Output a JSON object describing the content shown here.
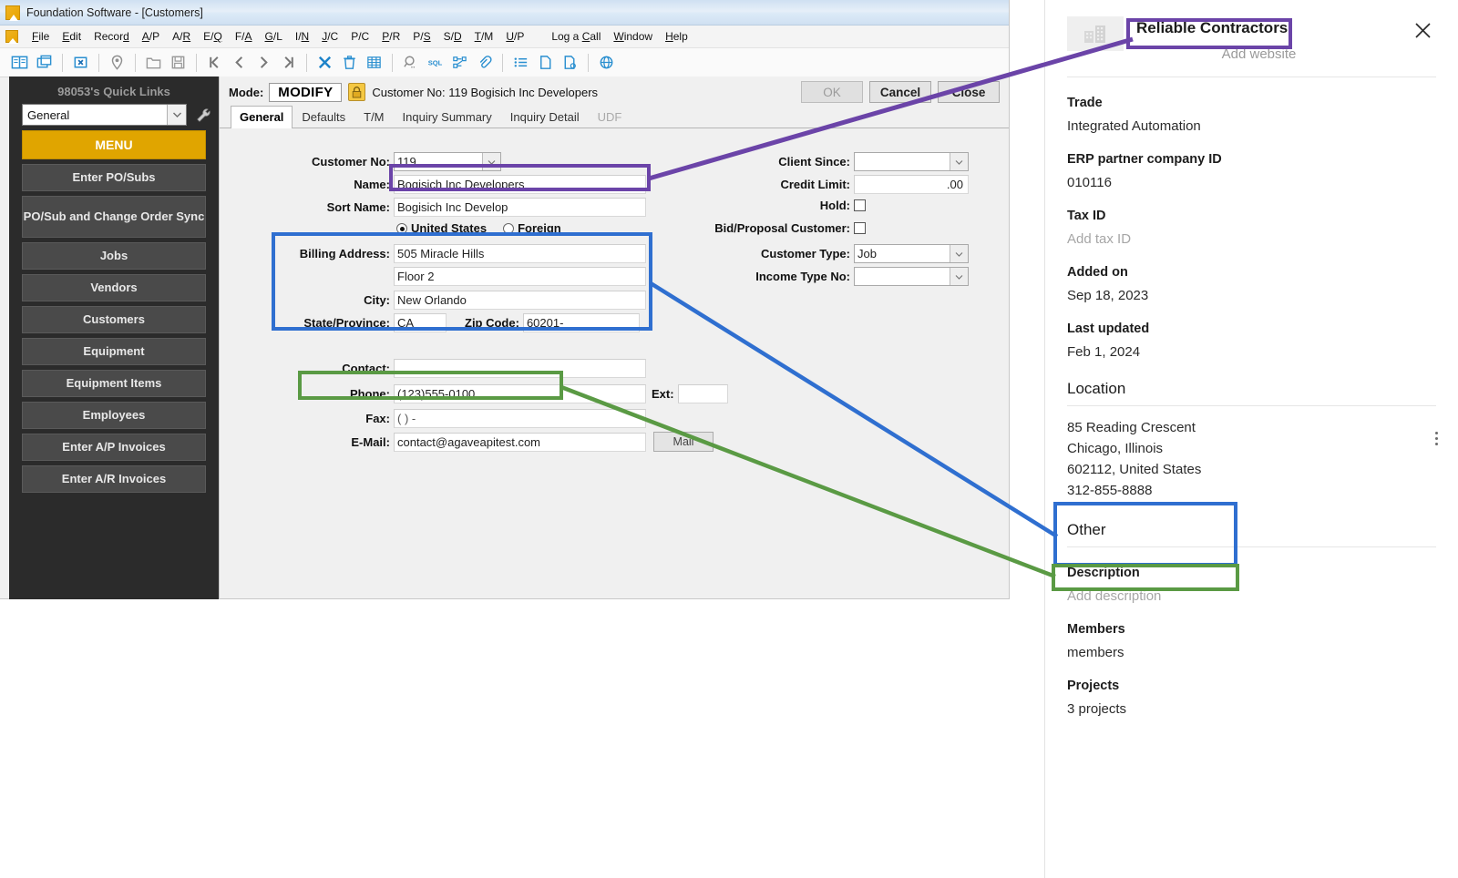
{
  "window": {
    "title": "Foundation Software - [Customers]",
    "app_icon": "foundation-logo-icon"
  },
  "menubar": {
    "items": [
      {
        "label": "File",
        "accel": "F"
      },
      {
        "label": "Edit",
        "accel": "E"
      },
      {
        "label": "Record",
        "accel": "d"
      },
      {
        "label": "A/P",
        "accel": "A"
      },
      {
        "label": "A/R",
        "accel": "R"
      },
      {
        "label": "E/Q",
        "accel": "Q"
      },
      {
        "label": "F/A",
        "accel": "A"
      },
      {
        "label": "G/L",
        "accel": "G"
      },
      {
        "label": "I/N",
        "accel": "N"
      },
      {
        "label": "J/C",
        "accel": "J"
      },
      {
        "label": "P/C",
        "accel": "P"
      },
      {
        "label": "P/R",
        "accel": "P"
      },
      {
        "label": "P/S",
        "accel": "S"
      },
      {
        "label": "S/D",
        "accel": "D"
      },
      {
        "label": "T/M",
        "accel": "T"
      },
      {
        "label": "U/P",
        "accel": "U"
      },
      {
        "label": "Log a Call",
        "accel": "C"
      },
      {
        "label": "Window",
        "accel": "W"
      },
      {
        "label": "Help",
        "accel": "H"
      }
    ]
  },
  "toolbar": {
    "icons": [
      "book-open-icon",
      "copy-windows-icon",
      "close-box-icon",
      "location-pin-icon",
      "new-folder-icon",
      "save-disk-icon",
      "first-record-icon",
      "previous-record-icon",
      "next-record-icon",
      "last-record-icon",
      "delete-x-icon",
      "trash-icon",
      "grid-icon",
      "find-icon",
      "sql-icon",
      "workflow-icon",
      "attachment-icon",
      "list-icon",
      "document-icon",
      "document-info-icon",
      "globe-icon"
    ]
  },
  "sidebar": {
    "title": "98053's Quick Links",
    "dropdown_value": "General",
    "dropdown_icon": "chevron-down-icon",
    "settings_icon": "wrench-icon",
    "buttons": [
      {
        "label": "MENU",
        "primary": true
      },
      {
        "label": "Enter PO/Subs"
      },
      {
        "label": "PO/Sub and Change Order Sync",
        "tall": true
      },
      {
        "label": "Jobs"
      },
      {
        "label": "Vendors"
      },
      {
        "label": "Customers"
      },
      {
        "label": "Equipment"
      },
      {
        "label": "Equipment Items"
      },
      {
        "label": "Employees"
      },
      {
        "label": "Enter A/P Invoices"
      },
      {
        "label": "Enter A/R Invoices"
      }
    ]
  },
  "form": {
    "mode_label": "Mode:",
    "mode_value": "MODIFY",
    "lock_icon": "lock-icon",
    "record_header": "Customer No: 119  Bogisich Inc Developers",
    "buttons": {
      "ok": "OK",
      "cancel": "Cancel",
      "close": "Close"
    },
    "tabs": [
      {
        "label": "General",
        "active": true
      },
      {
        "label": "Defaults"
      },
      {
        "label": "T/M"
      },
      {
        "label": "Inquiry Summary"
      },
      {
        "label": "Inquiry Detail"
      },
      {
        "label": "UDF",
        "disabled": true
      }
    ],
    "left_fields": {
      "customer_no_label": "Customer No:",
      "customer_no_value": "119",
      "name_label": "Name:",
      "name_value": "Bogisich Inc Developers",
      "sort_name_label": "Sort Name:",
      "sort_name_value": "Bogisich Inc Develop",
      "radio_us": "United States",
      "radio_foreign": "Foreign",
      "billing_address_label": "Billing Address:",
      "billing_address_line1": "505 Miracle Hills",
      "billing_address_line2": "Floor 2",
      "city_label": "City:",
      "city_value": "New Orlando",
      "state_label": "State/Province:",
      "state_value": "CA",
      "zip_label": "Zip Code:",
      "zip_value": "60201-",
      "contact_label": "Contact:",
      "contact_value": "",
      "phone_label": "Phone:",
      "phone_value": "(123)555-0100",
      "ext_label": "Ext:",
      "ext_value": "",
      "fax_label": "Fax:",
      "fax_value": "(   )   -",
      "email_label": "E-Mail:",
      "email_value": "contact@agaveapitest.com",
      "mail_button": "Mail"
    },
    "right_fields": {
      "client_since_label": "Client Since:",
      "client_since_value": "",
      "credit_limit_label": "Credit Limit:",
      "credit_limit_value": ".00",
      "hold_label": "Hold:",
      "bid_proposal_label": "Bid/Proposal Customer:",
      "customer_type_label": "Customer Type:",
      "customer_type_value": "Job",
      "income_type_label": "Income Type No:",
      "income_type_value": ""
    }
  },
  "crm": {
    "company_name": "Reliable Contractors",
    "company_logo_icon": "office-building-icon",
    "website_placeholder": "Add website",
    "close_icon": "close-icon",
    "fields": [
      {
        "label": "Trade",
        "value": "Integrated Automation",
        "muted": false
      },
      {
        "label": "ERP partner company ID",
        "value": "010116",
        "muted": false
      },
      {
        "label": "Tax ID",
        "value": "Add tax ID",
        "muted": true
      },
      {
        "label": "Added on",
        "value": "Sep 18, 2023",
        "muted": false
      },
      {
        "label": "Last updated",
        "value": "Feb 1, 2024",
        "muted": false
      }
    ],
    "location": {
      "heading": "Location",
      "address_line1": "85 Reading Crescent",
      "address_line2": "Chicago, Illinois",
      "address_line3": "602112, United States",
      "phone": "312-855-8888",
      "menu_icon": "kebab-menu-icon"
    },
    "other": {
      "heading": "Other",
      "fields": [
        {
          "label": "Description",
          "value": "Add description",
          "muted": true
        },
        {
          "label": "Members",
          "value": "members",
          "muted": false
        },
        {
          "label": "Projects",
          "value": "3 projects",
          "muted": false
        }
      ]
    }
  },
  "annotations": {
    "colors": {
      "purple": "#6B44A8",
      "blue": "#2F6FD0",
      "green": "#5A9A44"
    },
    "links": [
      {
        "name": "name-to-company-name",
        "color": "purple"
      },
      {
        "name": "billing-address-to-location",
        "color": "blue"
      },
      {
        "name": "phone-to-location-phone",
        "color": "green"
      }
    ]
  }
}
